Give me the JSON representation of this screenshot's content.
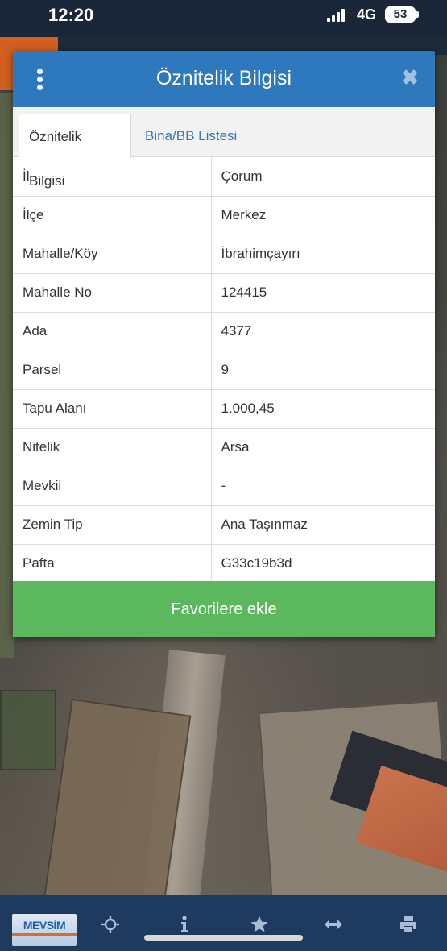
{
  "status_bar": {
    "time": "12:20",
    "network": "4G",
    "battery": "53"
  },
  "dialog": {
    "title": "Öznitelik Bilgisi",
    "menu_icon": "kebab-menu-icon",
    "close_icon": "close-icon",
    "tabs": [
      {
        "label": "Öznitelik Bilgisi",
        "active": true
      },
      {
        "label": "Bina/BB Listesi",
        "active": false
      }
    ],
    "rows": [
      {
        "key": "İl",
        "value": "Çorum"
      },
      {
        "key": "İlçe",
        "value": "Merkez"
      },
      {
        "key": "Mahalle/Köy",
        "value": "İbrahimçayırı"
      },
      {
        "key": "Mahalle No",
        "value": "124415"
      },
      {
        "key": "Ada",
        "value": "4377"
      },
      {
        "key": "Parsel",
        "value": "9"
      },
      {
        "key": "Tapu Alanı",
        "value": "1.000,45"
      },
      {
        "key": "Nitelik",
        "value": "Arsa"
      },
      {
        "key": "Mevkii",
        "value": "-"
      },
      {
        "key": "Zemin Tip",
        "value": "Ana Taşınmaz"
      },
      {
        "key": "Pafta",
        "value": "G33c19b3d"
      }
    ],
    "favorite_button": "Favorilere ekle"
  },
  "toolbar": {
    "logo_text": "MEVSİM",
    "tools": [
      "crosshair-icon",
      "info-icon",
      "star-icon",
      "measure-icon",
      "print-icon"
    ]
  },
  "colors": {
    "header_blue": "#2e78bd",
    "button_green": "#5cb85c",
    "toolbar_navy": "#1f3a5f"
  }
}
